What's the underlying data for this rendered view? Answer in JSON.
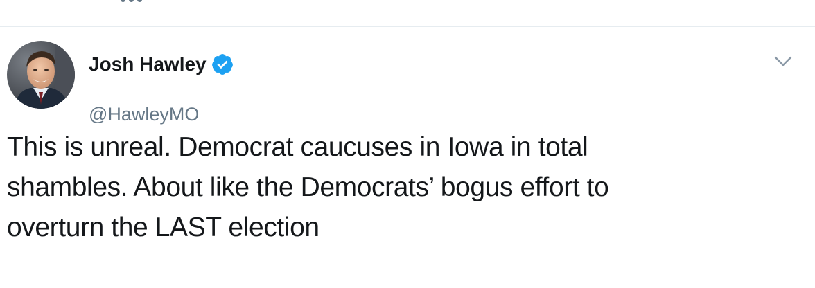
{
  "tweet": {
    "author": {
      "display_name": "Josh Hawley",
      "handle": "@HawleyMO",
      "verified": true,
      "avatar_icon": "profile-photo"
    },
    "text": "This is unreal. Democrat caucuses in Iowa in total\nshambles. About like the Democrats’ bogus effort to\noverturn the LAST election",
    "menu_icon": "chevron-down-icon"
  },
  "colors": {
    "text_primary": "#14171a",
    "text_secondary": "#657786",
    "verified_blue": "#1da1f2",
    "divider": "#e6ecf0",
    "background": "#ffffff"
  }
}
